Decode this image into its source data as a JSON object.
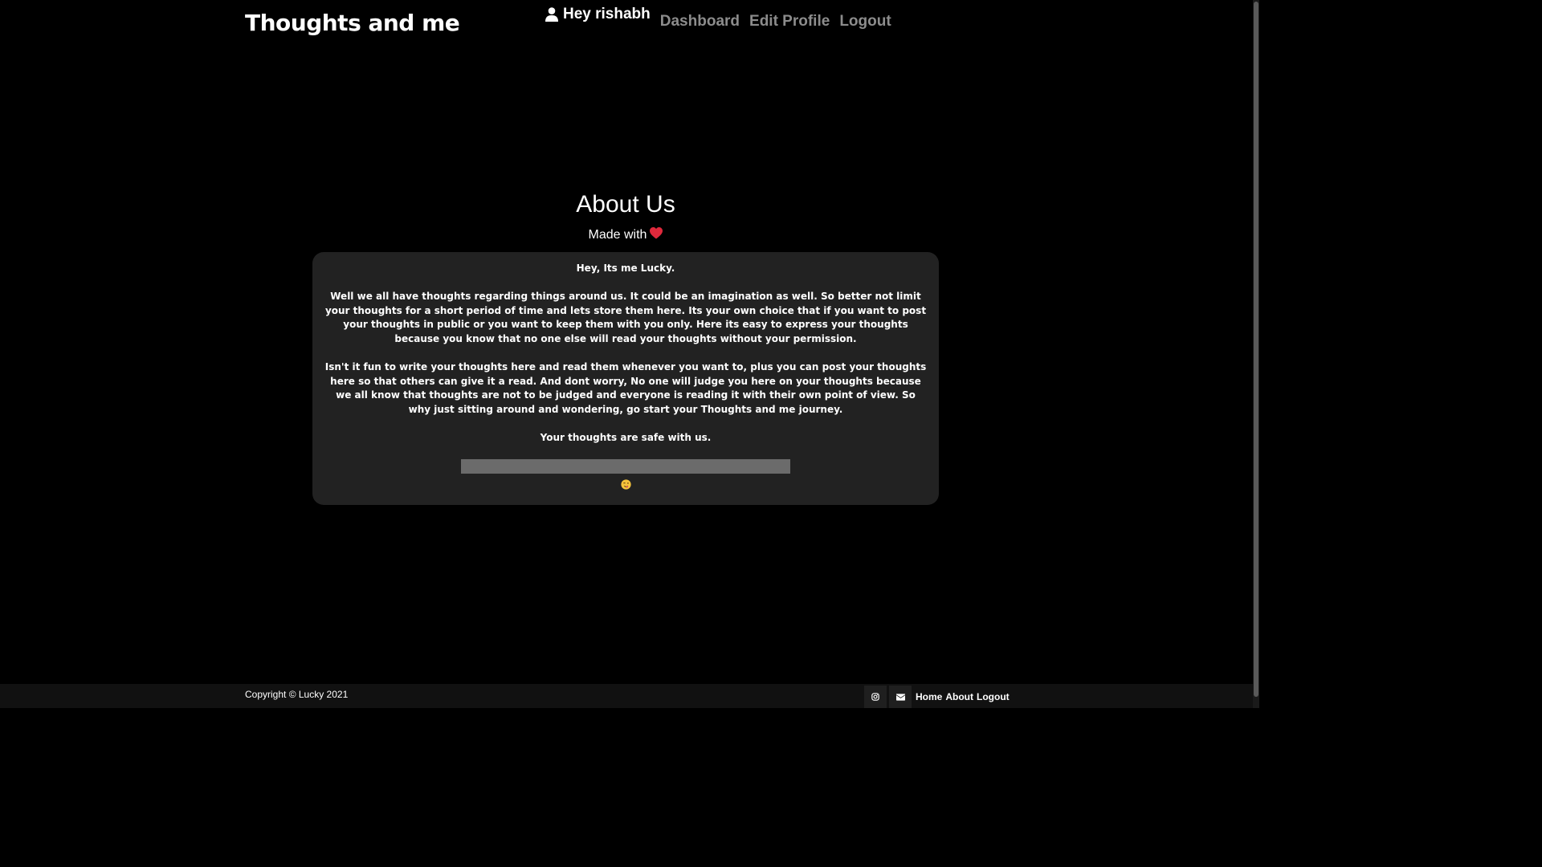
{
  "header": {
    "brand": "Thoughts and me",
    "greeting": "Hey rishabh",
    "nav": [
      "Dashboard",
      "Edit Profile",
      "Logout"
    ]
  },
  "hero": {
    "title": "About Us",
    "subtitle": "Made with"
  },
  "card": {
    "paragraphs": [
      "Hey, Its me Lucky.",
      "Well we all have thoughts regarding things around us. It could be an imagination as well. So better not limit your thoughts for a short period of time and lets store them here. Its your own choice that if you want to post your thoughts in public or you want to keep them with you only. Here its easy to express your thoughts because you know that no one else will read your thoughts without your permission.",
      "Isn't it fun to write your thoughts here and read them whenever you want to, plus you can post your thoughts here so that others can give it a read. And dont worry, No one will judge you here on your thoughts because we all know that thoughts are not to be judged and everyone is reading it with their own point of view. So why just sitting around and wondering, go start your Thoughts and me journey.",
      "Your thoughts are safe with us."
    ]
  },
  "footer": {
    "copyright": "Copyright © Lucky 2021",
    "links": [
      "Home",
      "About",
      "Logout"
    ]
  },
  "icons": {
    "user": "user-icon",
    "heart": "heart-icon",
    "wink": "wink-emoji-icon",
    "instagram": "instagram-icon",
    "mail": "mail-icon"
  },
  "colors": {
    "background": "#000000",
    "card": "#222222",
    "nav_link": "#8c8c8c",
    "heart": "#e0293c",
    "progress_track": "#6b6b6b"
  }
}
